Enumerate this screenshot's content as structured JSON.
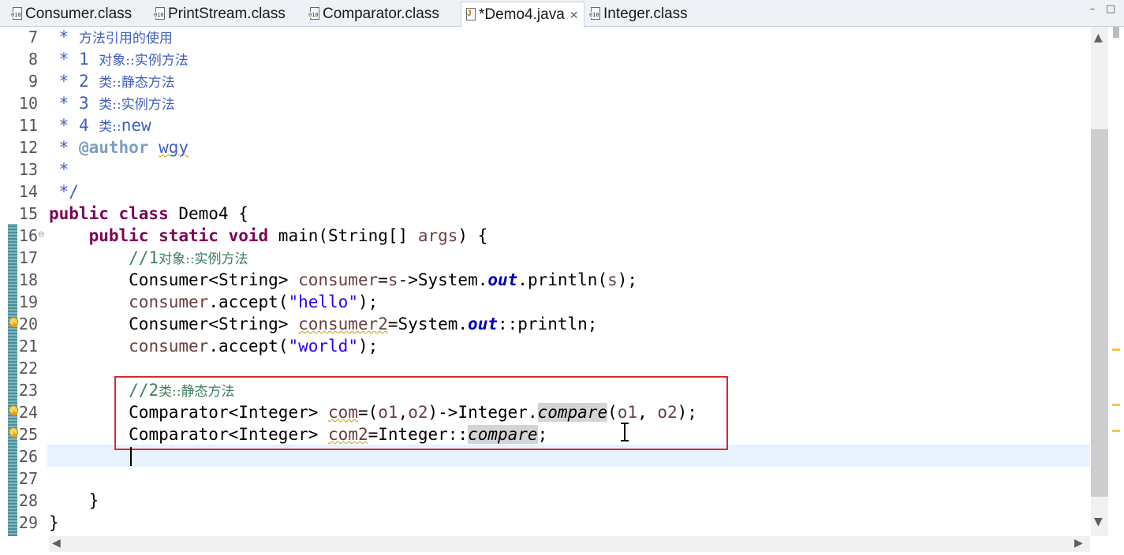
{
  "tabs": [
    {
      "label": "Consumer.class",
      "icon": "class-file-icon",
      "active": false
    },
    {
      "label": "PrintStream.class",
      "icon": "class-file-icon",
      "active": false
    },
    {
      "label": "Comparator.class",
      "icon": "class-file-icon",
      "active": false
    },
    {
      "label": "*Demo4.java",
      "icon": "java-file-icon",
      "active": true
    },
    {
      "label": "Integer.class",
      "icon": "class-file-icon",
      "active": false
    }
  ],
  "close_glyph": "✕",
  "window_controls": {
    "minimize": "–",
    "maximize": "□"
  },
  "lines": {
    "l7": {
      "no": "7",
      "star": " * ",
      "text": "方法引用的使用"
    },
    "l8": {
      "no": "8",
      "star": " * ",
      "num": "1",
      "text": "对象::实例方法"
    },
    "l9": {
      "no": "9",
      "star": " * ",
      "num": "2",
      "text": "类::静态方法"
    },
    "l10": {
      "no": "10",
      "star": " * ",
      "num": "3",
      "text": "类::实例方法"
    },
    "l11": {
      "no": "11",
      "star": " * ",
      "num": "4",
      "text": "类::",
      "text2": "new"
    },
    "l12": {
      "no": "12",
      "star": " * ",
      "tag": "@author",
      "name": "wgy"
    },
    "l13": {
      "no": "13",
      "star": " *"
    },
    "l14": {
      "no": "14",
      "star": " */"
    },
    "l15": {
      "no": "15",
      "kw": "public class",
      "rest": " Demo4 {"
    },
    "l16": {
      "no": "16",
      "kw": "public static void",
      "rest": " main(String[] ",
      "arg": "args",
      "end": ") {"
    },
    "l17": {
      "no": "17",
      "comment": "//1",
      "cjk": "对象::实例方法"
    },
    "l18": {
      "no": "18",
      "t1": "Consumer<String> ",
      "v1": "consumer",
      "t2": "=",
      "v2": "s",
      "t3": "->System.",
      "f": "out",
      "t4": ".println(",
      "v3": "s",
      "t5": ");"
    },
    "l19": {
      "no": "19",
      "v1": "consumer",
      "t1": ".accept(",
      "s": "\"hello\"",
      "t2": ");"
    },
    "l20": {
      "no": "20",
      "t1": "Consumer<String> ",
      "v1": "consumer2",
      "t2": "=System.",
      "f": "out",
      "t3": "::println;"
    },
    "l21": {
      "no": "21",
      "v1": "consumer",
      "t1": ".accept(",
      "s": "\"world\"",
      "t2": ");"
    },
    "l22": {
      "no": "22"
    },
    "l23": {
      "no": "23",
      "comment": "//2",
      "cjk": "类::静态方法"
    },
    "l24": {
      "no": "24",
      "t1": "Comparator<Integer> ",
      "v1": "com",
      "t2": "=(",
      "v2": "o1",
      "t3": ",",
      "v3": "o2",
      "t4": ")->Integer.",
      "m": "compare",
      "t5": "(",
      "v4": "o1",
      "t6": ", ",
      "v5": "o2",
      "t7": ");"
    },
    "l25": {
      "no": "25",
      "t1": "Comparator<Integer> ",
      "v1": "com2",
      "t2": "=Integer::",
      "m": "compare",
      "t3": ";"
    },
    "l26": {
      "no": "26"
    },
    "l27": {
      "no": "27"
    },
    "l28": {
      "no": "28",
      "text": "}"
    },
    "l29": {
      "no": "29",
      "text": "}"
    }
  }
}
